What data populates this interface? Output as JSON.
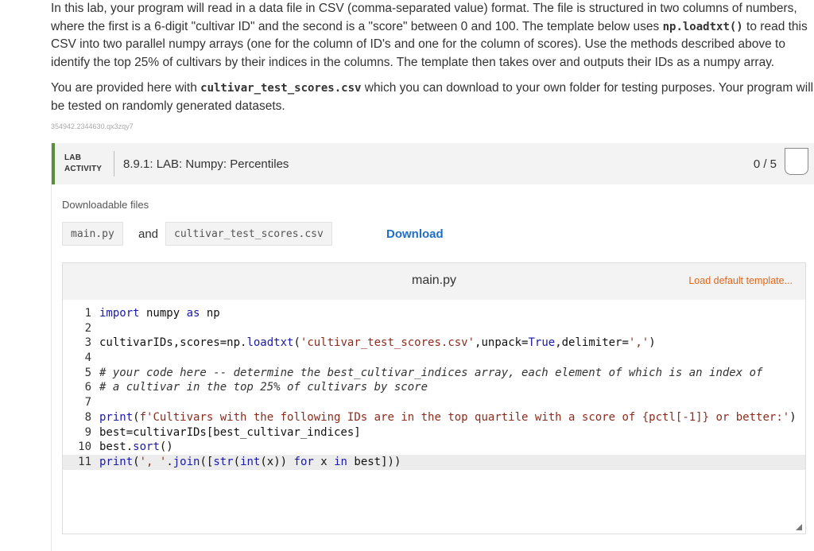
{
  "intro": {
    "p1_a": "In this lab, your program will read in a data file in CSV (comma-separated value) format. The file is structured in two columns of numbers, where the first is a 6-digit \"cultivar ID\" and the second is a \"score\" between 0 and 100. The template below uses ",
    "p1_code": "np.loadtxt()",
    "p1_b": " to read this CSV into two parallel numpy arrays (one for the column of ID's and one for the column of scores). Use the methods described above to identify the top 25% of cultivars by their indices in the columns. The template then takes over and outputs their IDs as a numpy array.",
    "p2_a": "You are provided here with ",
    "p2_code": "cultivar_test_scores.csv",
    "p2_b": " which you can download to your own folder for testing purposes. Your program will be tested on randomly generated datasets.",
    "meta_id": "354942.2344630.qx3zqy7"
  },
  "lab": {
    "type_line1": "LAB",
    "type_line2": "ACTIVITY",
    "title": "8.9.1: LAB: Numpy: Percentiles",
    "score": "0 / 5"
  },
  "downloads": {
    "label": "Downloadable files",
    "file1": "main.py",
    "and_text": "and",
    "file2": "cultivar_test_scores.csv",
    "download_label": "Download"
  },
  "editor": {
    "filename": "main.py",
    "load_default_label": "Load default template...",
    "line_numbers": [
      "1",
      "2",
      "3",
      "4",
      "5",
      "6",
      "7",
      "8",
      "9",
      "10",
      "11"
    ],
    "lines": [
      "import numpy as np",
      "",
      "cultivarIDs,scores=np.loadtxt('cultivar_test_scores.csv',unpack=True,delimiter=',')",
      "",
      "# your code here -- determine the best_cultivar_indices array, each element of which is an index of",
      "# a cultivar in the top 25% of cultivars by score",
      "",
      "print(f'Cultivars with the following IDs are in the top quartile with a score of {pctl[-1]} or better:')",
      "best=cultivarIDs[best_cultivar_indices]",
      "best.sort()",
      "print(', '.join([str(int(x)) for x in best]))"
    ]
  }
}
